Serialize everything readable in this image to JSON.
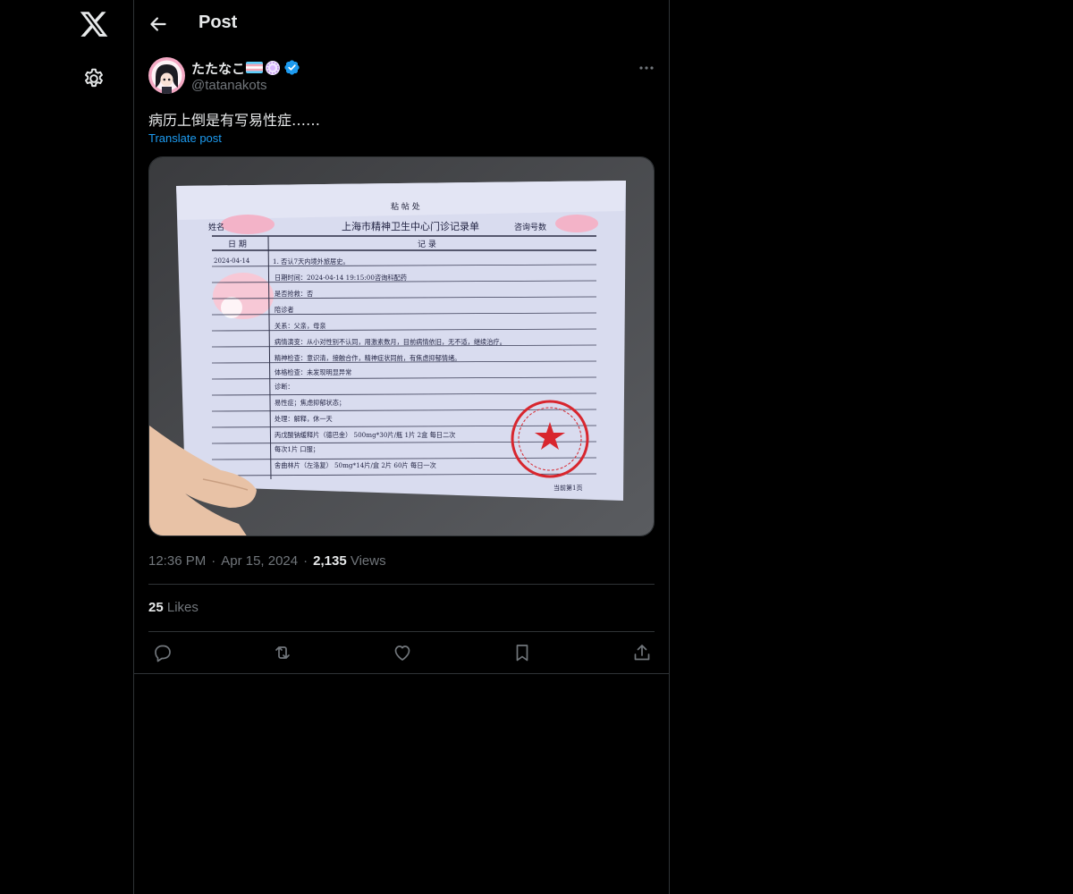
{
  "header": {
    "title": "Post"
  },
  "post": {
    "author": {
      "display_name": "たたなこ",
      "handle": "@tatanakots"
    },
    "text": "病历上倒是有写易性症……",
    "translate_label": "Translate post",
    "time": "12:36 PM",
    "date": "Apr 15, 2024",
    "views_count": "2,135",
    "views_label": "Views",
    "likes_count": "25",
    "likes_label": "Likes"
  },
  "media": {
    "stamp_text": "粘 帖 处",
    "doc_title": "上海市精神卫生中心门诊记录单",
    "name_label": "姓名",
    "consult_label": "咨询号数",
    "col_date": "日 期",
    "col_record": "记 录",
    "date_cell": "2024-04-14",
    "lines": [
      "1. 否认7天内境外旅居史。",
      "日期时间：2024-04-14 19:15:00咨询科配药",
      "是否抢救：否",
      "陪诊者",
      "关系：父亲，母亲",
      "病情演变：从小对性别不认同，用激素数月，目前病情依旧，无不适，继续治疗。",
      "精神检查：意识清，接触合作，精神症状同前，有焦虑抑郁情绪。",
      "体格检查：未发现明显异常",
      "诊断：",
      "易性症；焦虑抑郁状态；",
      "处理：解释，休一天",
      "丙戊酸钠缓释片（德巴金）  500mg*30片/瓶    1片   2盒   每日二次",
      "每次1片      口服；",
      "舍曲林片（左洛复）     50mg*14片/盒     2片    60片   每日一次"
    ],
    "page_label": "当前第1页"
  },
  "colors": {
    "accent": "#1d9bf0",
    "bg": "#000000",
    "muted": "#71767b",
    "border": "#2f3336"
  }
}
